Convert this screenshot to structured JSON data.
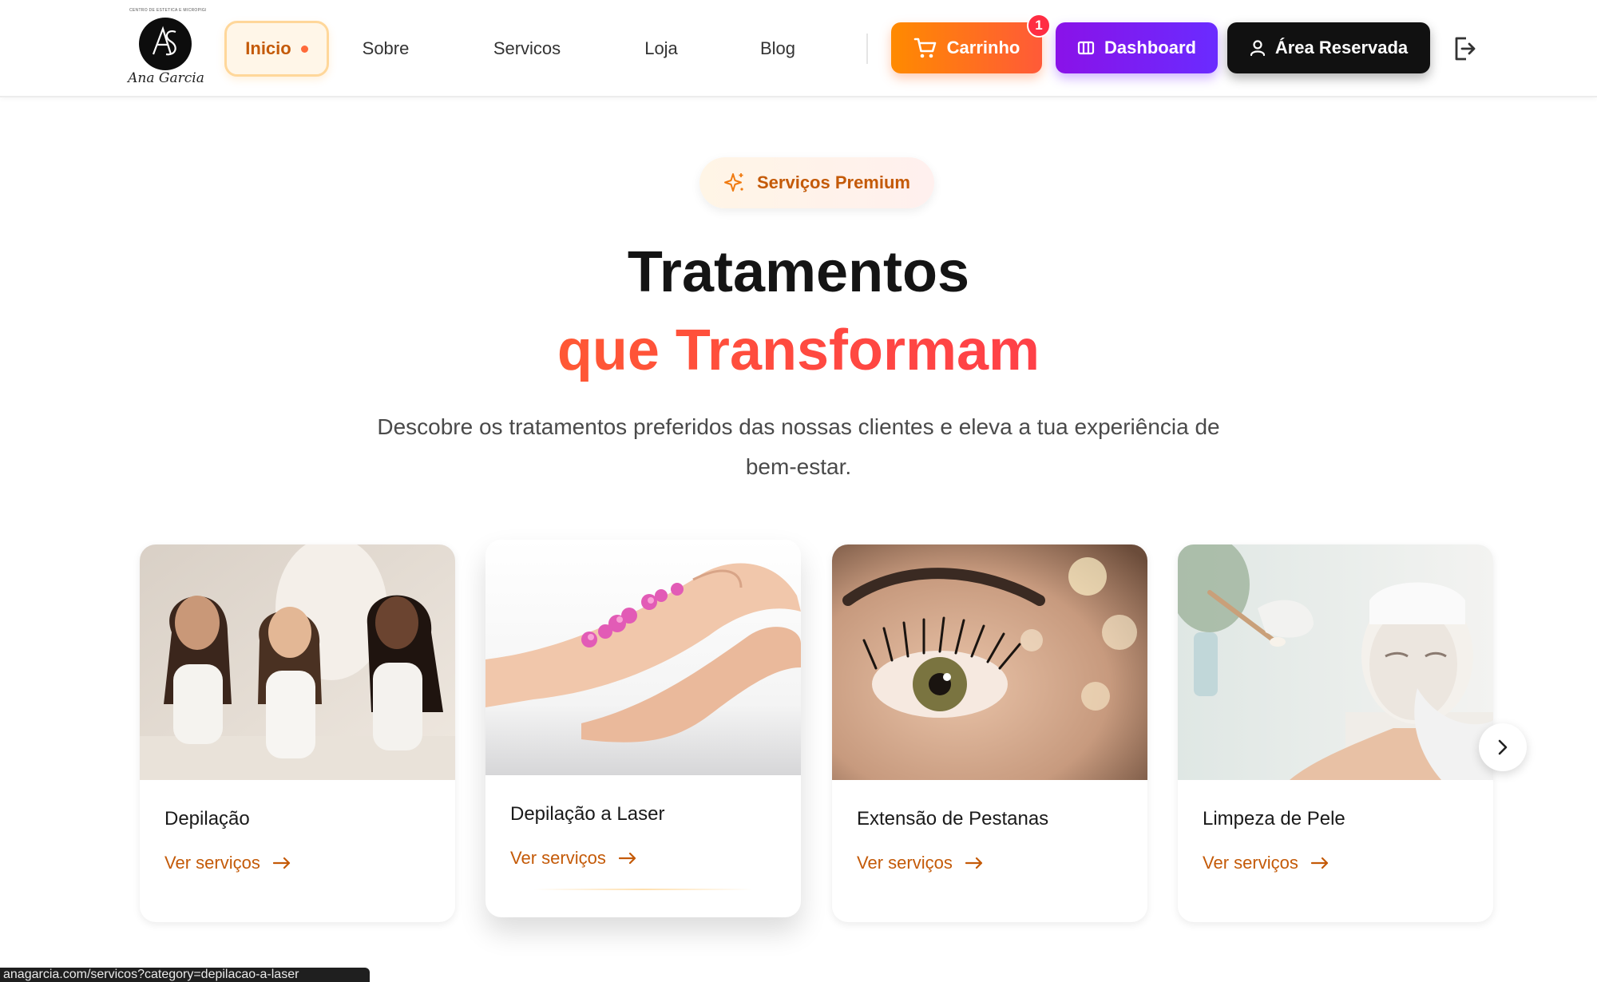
{
  "brand": {
    "tagline": "CENTRO DE ESTÉTICA E MICROPIGMENTAÇÃO",
    "script_name": "Ana Garcia"
  },
  "nav": {
    "items": [
      {
        "label": "Inicio",
        "active": true
      },
      {
        "label": "Sobre"
      },
      {
        "label": "Servicos"
      },
      {
        "label": "Loja"
      },
      {
        "label": "Blog"
      }
    ]
  },
  "actions": {
    "cart_label": "Carrinho",
    "cart_count": "1",
    "dashboard_label": "Dashboard",
    "reserved_label": "Área Reservada"
  },
  "hero": {
    "badge": "Serviços Premium",
    "title_line1": "Tratamentos",
    "title_line2": "que Transformam",
    "subtitle": "Descobre os tratamentos preferidos das nossas clientes e eleva a tua experiência de bem-estar."
  },
  "cards": [
    {
      "title": "Depilação",
      "link": "Ver serviços"
    },
    {
      "title": "Depilação a Laser",
      "link": "Ver serviços"
    },
    {
      "title": "Extensão de Pestanas",
      "link": "Ver serviços"
    },
    {
      "title": "Limpeza de Pele",
      "link": "Ver serviços"
    }
  ],
  "status_bar": {
    "url": "anagarcia.com/servicos?category=depilacao-a-laser"
  },
  "colors": {
    "accent_orange": "#c45a08",
    "cart_gradient": [
      "#ff8a00",
      "#ff5a38"
    ],
    "dashboard_gradient": [
      "#8a12e8",
      "#6a2bff"
    ],
    "dark": "#111111",
    "badge_red": "#ff2d43"
  },
  "icons": {
    "cart": "cart-icon",
    "dashboard": "columns-icon",
    "account": "user-icon",
    "logout": "logout-icon",
    "sparkle": "sparkle-icon",
    "arrow": "arrow-right-icon",
    "next": "chevron-right-icon"
  }
}
